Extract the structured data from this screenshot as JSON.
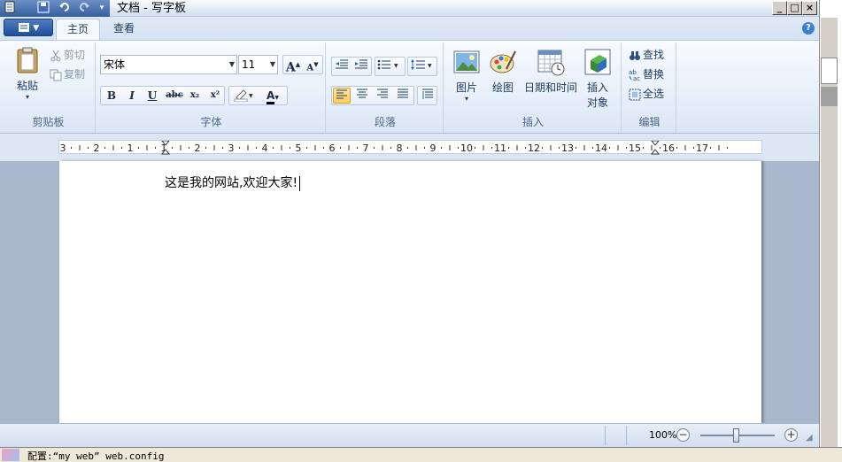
{
  "window": {
    "title": "文档 - 写字板",
    "controls": [
      "minimize",
      "maximize",
      "close"
    ]
  },
  "quick_access": [
    "save-icon",
    "undo-icon",
    "redo-icon",
    "customize-icon"
  ],
  "tabs": [
    {
      "label": "主页",
      "active": true
    },
    {
      "label": "查看",
      "active": false
    }
  ],
  "ribbon": {
    "clipboard": {
      "label": "剪贴板",
      "paste": "粘贴",
      "cut": "剪切",
      "copy": "复制"
    },
    "font": {
      "label": "字体",
      "family": "宋体",
      "size": "11",
      "bold": "B",
      "italic": "I",
      "underline": "U",
      "strike": "abc",
      "subscript": "x₂",
      "superscript": "x²",
      "grow": "A",
      "shrink": "A",
      "color_letter": "A"
    },
    "paragraph": {
      "label": "段落",
      "active_align": "left"
    },
    "insert": {
      "label": "插入",
      "picture": "图片",
      "paint": "绘图",
      "datetime": "日期和时间",
      "object_line1": "插入",
      "object_line2": "对象"
    },
    "editing": {
      "label": "编辑",
      "find": "查找",
      "replace": "替换",
      "select_all": "全选"
    }
  },
  "ruler": {
    "labels": [
      "3",
      "2",
      "1",
      "1",
      "2",
      "3",
      "4",
      "5",
      "6",
      "7",
      "8",
      "9",
      "10",
      "11",
      "12",
      "13",
      "14",
      "15",
      "16",
      "17"
    ]
  },
  "document": {
    "text": "这是我的网站,欢迎大家!"
  },
  "status": {
    "zoom": "100%"
  },
  "bottom_bar": {
    "text": "配置:“my web” web.config"
  },
  "colors": {
    "accent": "#1f4f9a",
    "ribbon": "#e4edf9",
    "font_color_bar": "#000000"
  }
}
